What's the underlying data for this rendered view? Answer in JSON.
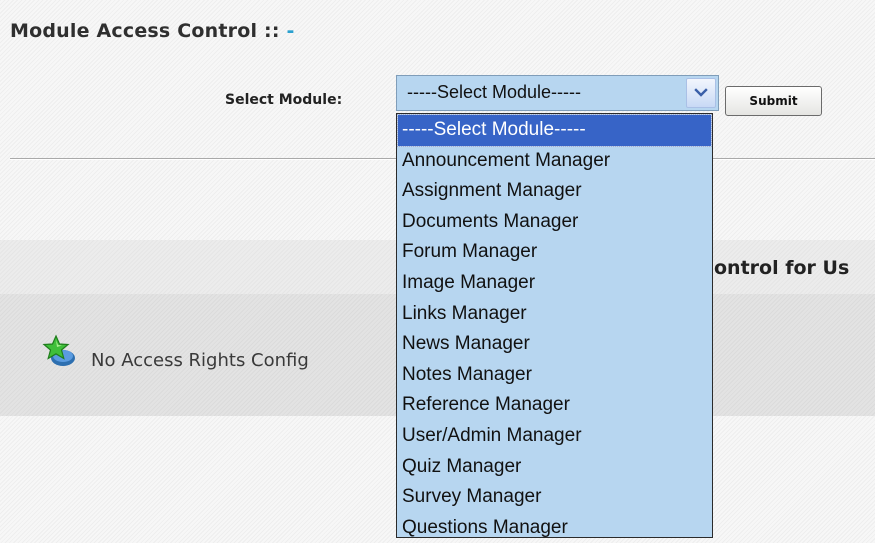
{
  "header": {
    "title": "Module Access Control",
    "separator": "::",
    "title_suffix": "-"
  },
  "module_select": {
    "label": "Select Module:",
    "selected_value": "-----Select Module-----",
    "submit_label": "Submit",
    "options": [
      "-----Select Module-----",
      "Announcement Manager",
      "Assignment Manager",
      "Documents Manager",
      "Forum Manager",
      "Image Manager",
      "Links Manager",
      "News Manager",
      "Notes Manager",
      "Reference Manager",
      "User/Admin Manager",
      "Quiz Manager",
      "Survey Manager",
      "Questions Manager"
    ],
    "highlighted_index": 0
  },
  "section": {
    "title_partial": "ontrol for Us",
    "empty_message": "No Access Rights Config"
  },
  "colors": {
    "accent": "#2aa0cf",
    "select_bg": "#b7d6f0",
    "highlight": "#3764c7"
  },
  "icons": {
    "status": "green-star-icon",
    "dropdown": "chevron-down-icon"
  }
}
